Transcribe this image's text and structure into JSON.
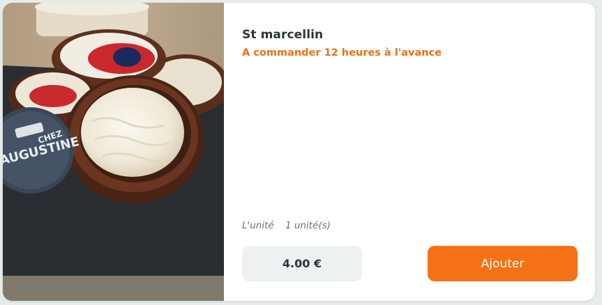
{
  "product": {
    "name": "St marcellin",
    "order_notice": "A commander 12 heures à l'avance",
    "unit_label": "L'unité",
    "unit_quantity": "1 unité(s)",
    "price": "4.00 €",
    "image_alt": "St marcellin"
  },
  "actions": {
    "add_label": "Ajouter"
  },
  "colors": {
    "accent": "#f57115",
    "notice": "#f07010",
    "title": "#2a3538",
    "price_bg": "#eef1f1"
  }
}
